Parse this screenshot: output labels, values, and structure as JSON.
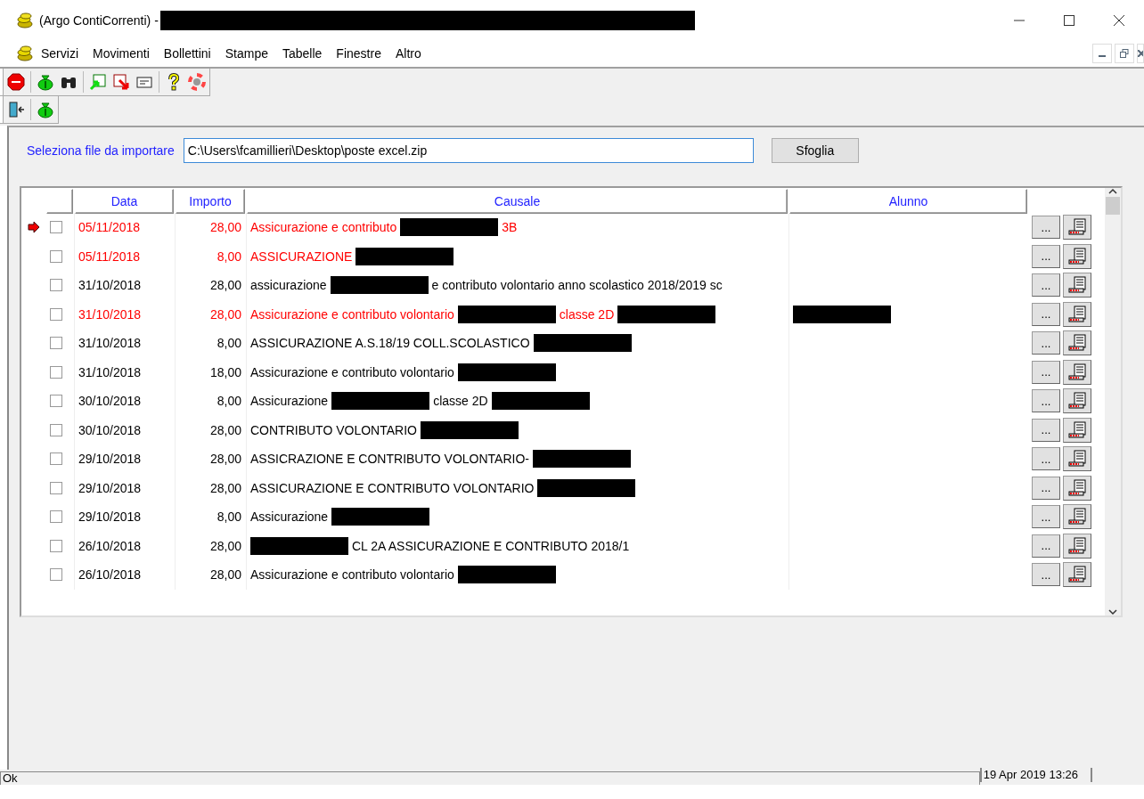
{
  "window": {
    "title": "(Argo ContiCorrenti) -"
  },
  "menu": [
    {
      "label": "Servizi"
    },
    {
      "label": "Movimenti"
    },
    {
      "label": "Bollettini"
    },
    {
      "label": "Stampe"
    },
    {
      "label": "Tabelle"
    },
    {
      "label": "Finestre"
    },
    {
      "label": "Altro"
    }
  ],
  "toolbar_1": [
    {
      "kind": "stop"
    },
    {
      "kind": "sep"
    },
    {
      "kind": "moneybag"
    },
    {
      "kind": "binoculars"
    },
    {
      "kind": "sep"
    },
    {
      "kind": "import"
    },
    {
      "kind": "export"
    },
    {
      "kind": "card"
    },
    {
      "kind": "sep"
    },
    {
      "kind": "help"
    },
    {
      "kind": "lifebuoy"
    }
  ],
  "toolbar_2": [
    {
      "kind": "exit"
    },
    {
      "kind": "sep"
    },
    {
      "kind": "moneybag"
    }
  ],
  "file_picker": {
    "label": "Seleziona file da importare",
    "value": "C:\\Users\\fcamillieri\\Desktop\\poste excel.zip",
    "button": "Sfoglia"
  },
  "table": {
    "columns": [
      "Data",
      "Importo",
      "Causale",
      "Alunno"
    ],
    "rows": [
      {
        "current": true,
        "checked": false,
        "color": "#ff0000",
        "data": "05/11/2018",
        "importo": "28,00",
        "causale": [
          {
            "kind": "text",
            "text": "Assicurazione e contributo"
          },
          {
            "kind": "redacted"
          },
          {
            "kind": "text",
            "text": "3B"
          }
        ],
        "alunno": [],
        "button": "..."
      },
      {
        "current": false,
        "checked": false,
        "color": "#ff0000",
        "data": "05/11/2018",
        "importo": "8,00",
        "causale": [
          {
            "kind": "text",
            "text": "ASSICURAZIONE"
          },
          {
            "kind": "redacted"
          }
        ],
        "alunno": [],
        "button": "..."
      },
      {
        "current": false,
        "checked": false,
        "color": "#000000",
        "data": "31/10/2018",
        "importo": "28,00",
        "causale": [
          {
            "kind": "text",
            "text": "assicurazione"
          },
          {
            "kind": "redacted"
          },
          {
            "kind": "text",
            "text": "e contributo volontario anno scolastico 2018/2019 sc"
          }
        ],
        "alunno": [],
        "button": "..."
      },
      {
        "current": false,
        "checked": false,
        "color": "#ff0000",
        "data": "31/10/2018",
        "importo": "28,00",
        "causale": [
          {
            "kind": "text",
            "text": "Assicurazione e contributo volontario"
          },
          {
            "kind": "redacted"
          },
          {
            "kind": "text",
            "text": "classe 2D"
          },
          {
            "kind": "redacted"
          }
        ],
        "alunno": [
          {
            "kind": "redacted"
          }
        ],
        "button": "..."
      },
      {
        "current": false,
        "checked": false,
        "color": "#000000",
        "data": "31/10/2018",
        "importo": "8,00",
        "causale": [
          {
            "kind": "text",
            "text": "ASSICURAZIONE A.S.18/19 COLL.SCOLASTICO"
          },
          {
            "kind": "redacted"
          }
        ],
        "alunno": [],
        "button": "..."
      },
      {
        "current": false,
        "checked": false,
        "color": "#000000",
        "data": "31/10/2018",
        "importo": "18,00",
        "causale": [
          {
            "kind": "text",
            "text": "Assicurazione e contributo volontario"
          },
          {
            "kind": "redacted"
          }
        ],
        "alunno": [],
        "button": "..."
      },
      {
        "current": false,
        "checked": false,
        "color": "#000000",
        "data": "30/10/2018",
        "importo": "8,00",
        "causale": [
          {
            "kind": "text",
            "text": "Assicurazione"
          },
          {
            "kind": "redacted"
          },
          {
            "kind": "text",
            "text": "classe 2D"
          },
          {
            "kind": "redacted"
          }
        ],
        "alunno": [],
        "button": "..."
      },
      {
        "current": false,
        "checked": false,
        "color": "#000000",
        "data": "30/10/2018",
        "importo": "28,00",
        "causale": [
          {
            "kind": "text",
            "text": "CONTRIBUTO VOLONTARIO"
          },
          {
            "kind": "redacted"
          }
        ],
        "alunno": [],
        "button": "..."
      },
      {
        "current": false,
        "checked": false,
        "color": "#000000",
        "data": "29/10/2018",
        "importo": "28,00",
        "causale": [
          {
            "kind": "text",
            "text": "ASSICRAZIONE E CONTRIBUTO VOLONTARIO-"
          },
          {
            "kind": "redacted"
          }
        ],
        "alunno": [],
        "button": "..."
      },
      {
        "current": false,
        "checked": false,
        "color": "#000000",
        "data": "29/10/2018",
        "importo": "28,00",
        "causale": [
          {
            "kind": "text",
            "text": "ASSICURAZIONE E CONTRIBUTO VOLONTARIO"
          },
          {
            "kind": "redacted"
          }
        ],
        "alunno": [],
        "button": "..."
      },
      {
        "current": false,
        "checked": false,
        "color": "#000000",
        "data": "29/10/2018",
        "importo": "8,00",
        "causale": [
          {
            "kind": "text",
            "text": "Assicurazione"
          },
          {
            "kind": "redacted"
          }
        ],
        "alunno": [],
        "button": "..."
      },
      {
        "current": false,
        "checked": false,
        "color": "#000000",
        "data": "26/10/2018",
        "importo": "28,00",
        "causale": [
          {
            "kind": "redacted"
          },
          {
            "kind": "text",
            "text": "CL 2A ASSICURAZIONE E CONTRIBUTO 2018/1"
          }
        ],
        "alunno": [],
        "button": "..."
      },
      {
        "current": false,
        "checked": false,
        "color": "#000000",
        "data": "26/10/2018",
        "importo": "28,00",
        "causale": [
          {
            "kind": "text",
            "text": "Assicurazione e contributo volontario"
          },
          {
            "kind": "redacted"
          }
        ],
        "alunno": [],
        "button": "..."
      }
    ]
  },
  "status_bar": {
    "message": "Ok",
    "datetime": "19 Apr 2019 13:26"
  }
}
